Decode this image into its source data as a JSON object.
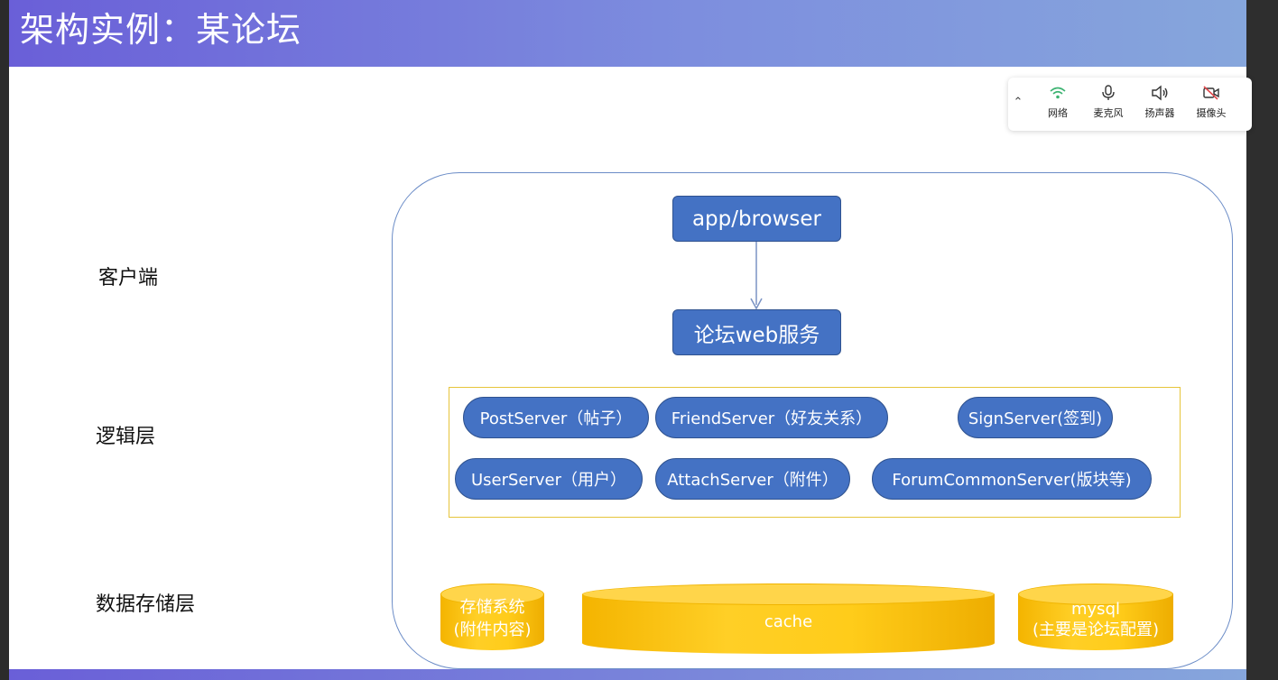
{
  "slide": {
    "title": "架构实例：某论坛"
  },
  "meeting_toolbar": {
    "collapse_icon": "chevron-up",
    "items": [
      {
        "icon": "wifi-icon",
        "label": "网络",
        "color": "#3cb371"
      },
      {
        "icon": "microphone-icon",
        "label": "麦克风",
        "color": "#333333"
      },
      {
        "icon": "speaker-icon",
        "label": "扬声器",
        "color": "#333333"
      },
      {
        "icon": "camera-off-icon",
        "label": "摄像头",
        "color": "#e0484b"
      }
    ]
  },
  "layers": {
    "client": "客户端",
    "logic": "逻辑层",
    "storage": "数据存储层"
  },
  "diagram": {
    "client_node": "app/browser",
    "web_node": "论坛web服务",
    "services": [
      "PostServer（帖子）",
      "FriendServer（好友关系）",
      "SignServer(签到)",
      "UserServer（用户）",
      "AttachServer（附件）",
      "ForumCommonServer(版块等)"
    ],
    "stores": [
      {
        "line1": "存储系统",
        "line2": "(附件内容)"
      },
      {
        "line1": "cache",
        "line2": ""
      },
      {
        "line1": "mysql",
        "line2": "(主要是论坛配置)"
      }
    ],
    "colors": {
      "node_fill": "#4472c4",
      "container_border": "#6b8cc7",
      "logic_border": "#e6c43a",
      "store_fill": "#ffc000"
    }
  }
}
